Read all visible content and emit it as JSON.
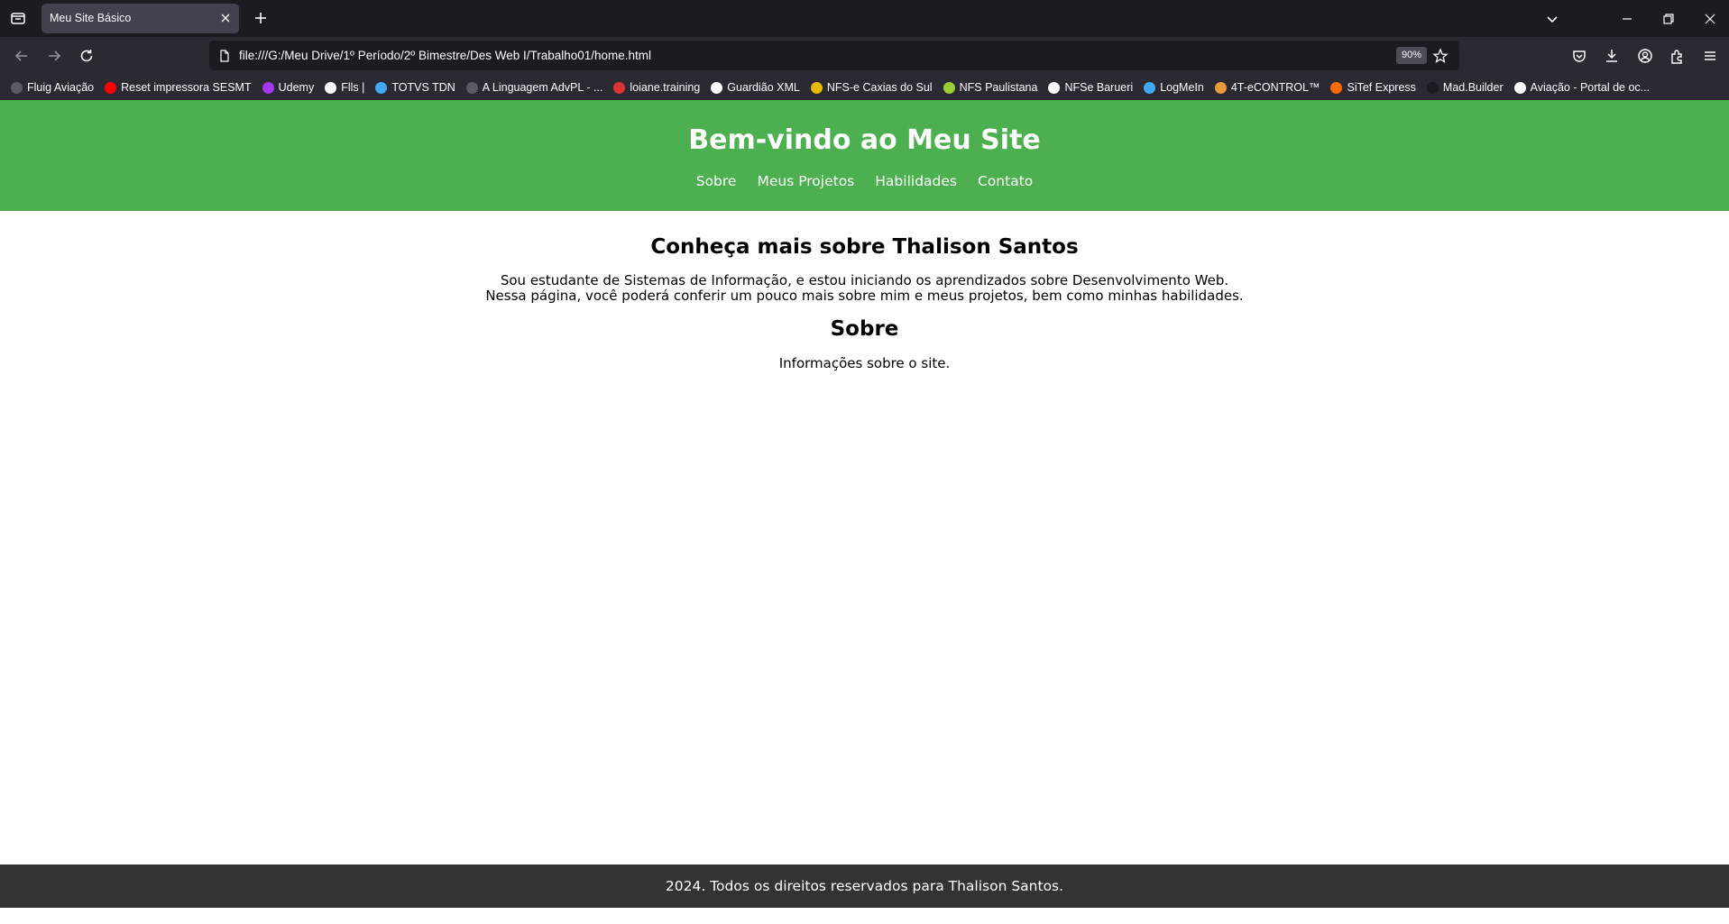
{
  "browser": {
    "tab_title": "Meu Site Básico",
    "url": "file:///G:/Meu Drive/1º Período/2º Bimestre/Des Web I/Trabalho01/home.html",
    "zoom": "90%",
    "bookmarks": [
      {
        "label": "Fluig Aviação",
        "icon_color": "#5b5b66"
      },
      {
        "label": "Reset impressora SESMT",
        "icon_color": "#ff0000"
      },
      {
        "label": "Udemy",
        "icon_color": "#a435f0"
      },
      {
        "label": "Flls |",
        "icon_color": "#fbfbfe"
      },
      {
        "label": "TOTVS TDN",
        "icon_color": "#3fa9f5"
      },
      {
        "label": "A Linguagem AdvPL - ...",
        "icon_color": "#5b5b66"
      },
      {
        "label": "loiane.training",
        "icon_color": "#dd3333"
      },
      {
        "label": "Guardião XML",
        "icon_color": "#fbfbfe"
      },
      {
        "label": "NFS-e Caxias do Sul",
        "icon_color": "#e6b800"
      },
      {
        "label": "NFS Paulistana",
        "icon_color": "#9acd32"
      },
      {
        "label": "NFSe Barueri",
        "icon_color": "#fbfbfe"
      },
      {
        "label": "LogMeIn",
        "icon_color": "#3fa9f5"
      },
      {
        "label": "4T-eCONTROL™",
        "icon_color": "#e89b3c"
      },
      {
        "label": "SiTef Express",
        "icon_color": "#ff6a00"
      },
      {
        "label": "Mad.Builder",
        "icon_color": "#1c1b22"
      },
      {
        "label": "Aviação - Portal de oc...",
        "icon_color": "#fbfbfe"
      }
    ]
  },
  "site": {
    "header_title": "Bem-vindo ao Meu Site",
    "nav": [
      "Sobre",
      "Meus Projetos",
      "Habilidades",
      "Contato"
    ],
    "intro_heading": "Conheça mais sobre Thalison Santos",
    "intro_line1": "Sou estudante de Sistemas de Informação, e estou iniciando os aprendizados sobre Desenvolvimento Web.",
    "intro_line2": "Nessa página, você poderá conferir um pouco mais sobre mim e meus projetos, bem como minhas habilidades.",
    "about_heading": "Sobre",
    "about_text": "Informações sobre o site.",
    "footer": "2024. Todos os direitos reservados para Thalison Santos.",
    "colors": {
      "header_bg": "#4caf50",
      "footer_bg": "#333333"
    }
  }
}
